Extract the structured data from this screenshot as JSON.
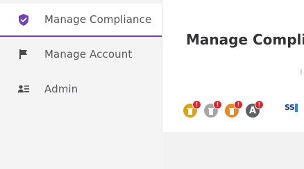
{
  "sidebar": {
    "items": [
      {
        "label": "Manage Compliance",
        "icon": "shield-check-icon",
        "active": true
      },
      {
        "label": "Manage Account",
        "icon": "flag-icon",
        "active": false
      },
      {
        "label": "Admin",
        "icon": "user-list-icon",
        "active": false
      }
    ]
  },
  "main": {
    "title": "Manage Complia",
    "badges": [
      {
        "icon": "gold-trash-icon",
        "color": "#d9a51d",
        "alert": "!"
      },
      {
        "icon": "gray-trash-icon",
        "color": "#a6a6a6",
        "alert": "!"
      },
      {
        "icon": "orange-trash-icon",
        "color": "#e1892b",
        "alert": "!"
      },
      {
        "icon": "a-letter-icon",
        "color": "#5f6066",
        "letter": "A",
        "alert": "!"
      }
    ],
    "ss_text": "SS"
  },
  "colors": {
    "accent": "#6f42b5",
    "alert": "#d6262e"
  }
}
